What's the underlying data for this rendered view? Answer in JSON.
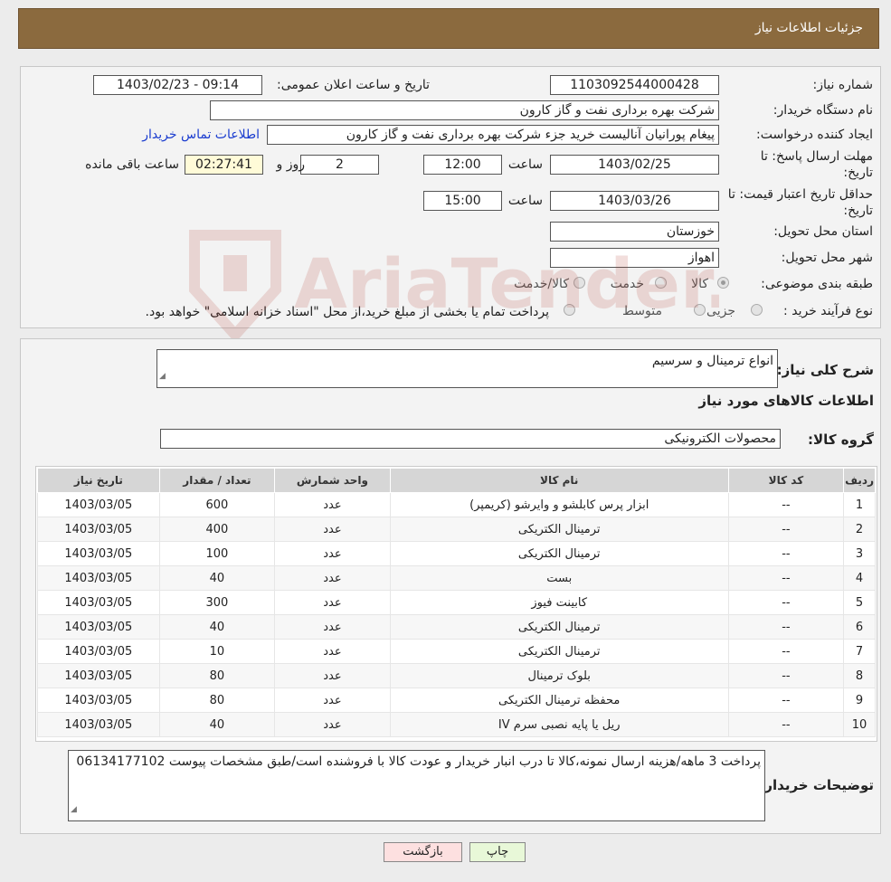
{
  "header": {
    "title": "جزئیات اطلاعات نیاز"
  },
  "details": {
    "need_number_label": "شماره نیاز:",
    "need_number": "1103092544000428",
    "announce_label": "تاریخ و ساعت اعلان عمومی:",
    "announce_value": "1403/02/23 - 09:14",
    "buyer_org_label": "نام دستگاه خریدار:",
    "buyer_org": "شرکت بهره برداری نفت و گاز کارون",
    "creator_label": "ایجاد کننده درخواست:",
    "creator": "پیغام پورانیان آنالیست خرید جزء شرکت بهره برداری نفت و گاز کارون",
    "contact_link": "اطلاعات تماس خریدار",
    "reply_deadline_label_1": "مهلت ارسال پاسخ: تا",
    "reply_deadline_label_2": "تاریخ:",
    "reply_date": "1403/02/25",
    "time_label": "ساعت",
    "reply_time": "12:00",
    "days_value": "2",
    "days_label": "روز و",
    "remaining_time": "02:27:41",
    "remaining_label": "ساعت باقی مانده",
    "price_validity_label_1": "حداقل تاریخ اعتبار قیمت: تا",
    "price_validity_label_2": "تاریخ:",
    "validity_date": "1403/03/26",
    "validity_time": "15:00",
    "province_label": "استان محل تحویل:",
    "province": "خوزستان",
    "city_label": "شهر محل تحویل:",
    "city": "اهواز",
    "category_label": "طبقه بندی موضوعی:",
    "category_options": [
      "کالا",
      "خدمت",
      "کالا/خدمت"
    ],
    "process_label": "نوع فرآیند خرید :",
    "process_options": [
      "جزیی",
      "متوسط"
    ],
    "process_note": "پرداخت تمام یا بخشی از مبلغ خرید،از محل \"اسناد خزانه اسلامی\" خواهد بود."
  },
  "goods": {
    "summary_label": "شرح کلی نیاز:",
    "summary": "انواع ترمینال و سرسیم",
    "section_title": "اطلاعات کالاهای مورد نیاز",
    "group_label": "گروه کالا:",
    "group": "محصولات الکترونیکی",
    "columns": [
      "ردیف",
      "کد کالا",
      "نام کالا",
      "واحد شمارش",
      "تعداد / مقدار",
      "تاریخ نیاز"
    ],
    "rows": [
      [
        "1",
        "--",
        "ابزار پرس کابلشو و وایرشو (کریمپر)",
        "عدد",
        "600",
        "1403/03/05"
      ],
      [
        "2",
        "--",
        "ترمینال الکتریکی",
        "عدد",
        "400",
        "1403/03/05"
      ],
      [
        "3",
        "--",
        "ترمینال الکتریکی",
        "عدد",
        "100",
        "1403/03/05"
      ],
      [
        "4",
        "--",
        "بست",
        "عدد",
        "40",
        "1403/03/05"
      ],
      [
        "5",
        "--",
        "کابینت فیوز",
        "عدد",
        "300",
        "1403/03/05"
      ],
      [
        "6",
        "--",
        "ترمینال الکتریکی",
        "عدد",
        "40",
        "1403/03/05"
      ],
      [
        "7",
        "--",
        "ترمینال الکتریکی",
        "عدد",
        "10",
        "1403/03/05"
      ],
      [
        "8",
        "--",
        "بلوک ترمینال",
        "عدد",
        "80",
        "1403/03/05"
      ],
      [
        "9",
        "--",
        "محفظه ترمینال الکتریکی",
        "عدد",
        "80",
        "1403/03/05"
      ],
      [
        "10",
        "--",
        "ریل یا پایه نصبی سرم IV",
        "عدد",
        "40",
        "1403/03/05"
      ]
    ],
    "buyer_notes_label": "توضیحات خریدار:",
    "buyer_notes": "پرداخت 3 ماهه/هزینه ارسال نمونه،کالا تا درب انبار خریدار و عودت کالا با فروشنده است/طبق مشخصات پیوست 06134177102"
  },
  "buttons": {
    "print": "چاپ",
    "back": "بازگشت"
  },
  "watermark": {
    "text": "AriaTender.neT",
    "color": "#b03a2e"
  },
  "colors": {
    "header": "#8b6a3e",
    "link": "#1a3ccf",
    "print_btn": "#e8f8d8",
    "back_btn": "#fde0e0"
  }
}
